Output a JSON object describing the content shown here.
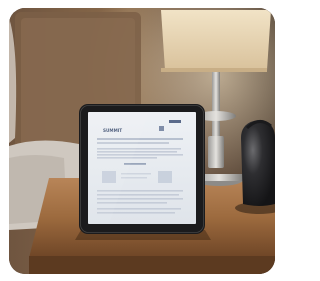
{
  "scene": {
    "subject": "tablet-on-nightstand",
    "colors": {
      "wall_warm": "#8a6a4a",
      "wall_dark": "#3a2a1e",
      "lamp_shade": "#e6d3b3",
      "lamp_glow": "#f6e7c8",
      "table_wood": "#a06f42",
      "tablet_bezel": "#1b1b1d",
      "screen_bg": "#e9ecf0",
      "pillow": "#cfc8c0",
      "kettle": "#2a2a2c"
    }
  },
  "tablet_screen": {
    "heading": "SUMMIT"
  }
}
